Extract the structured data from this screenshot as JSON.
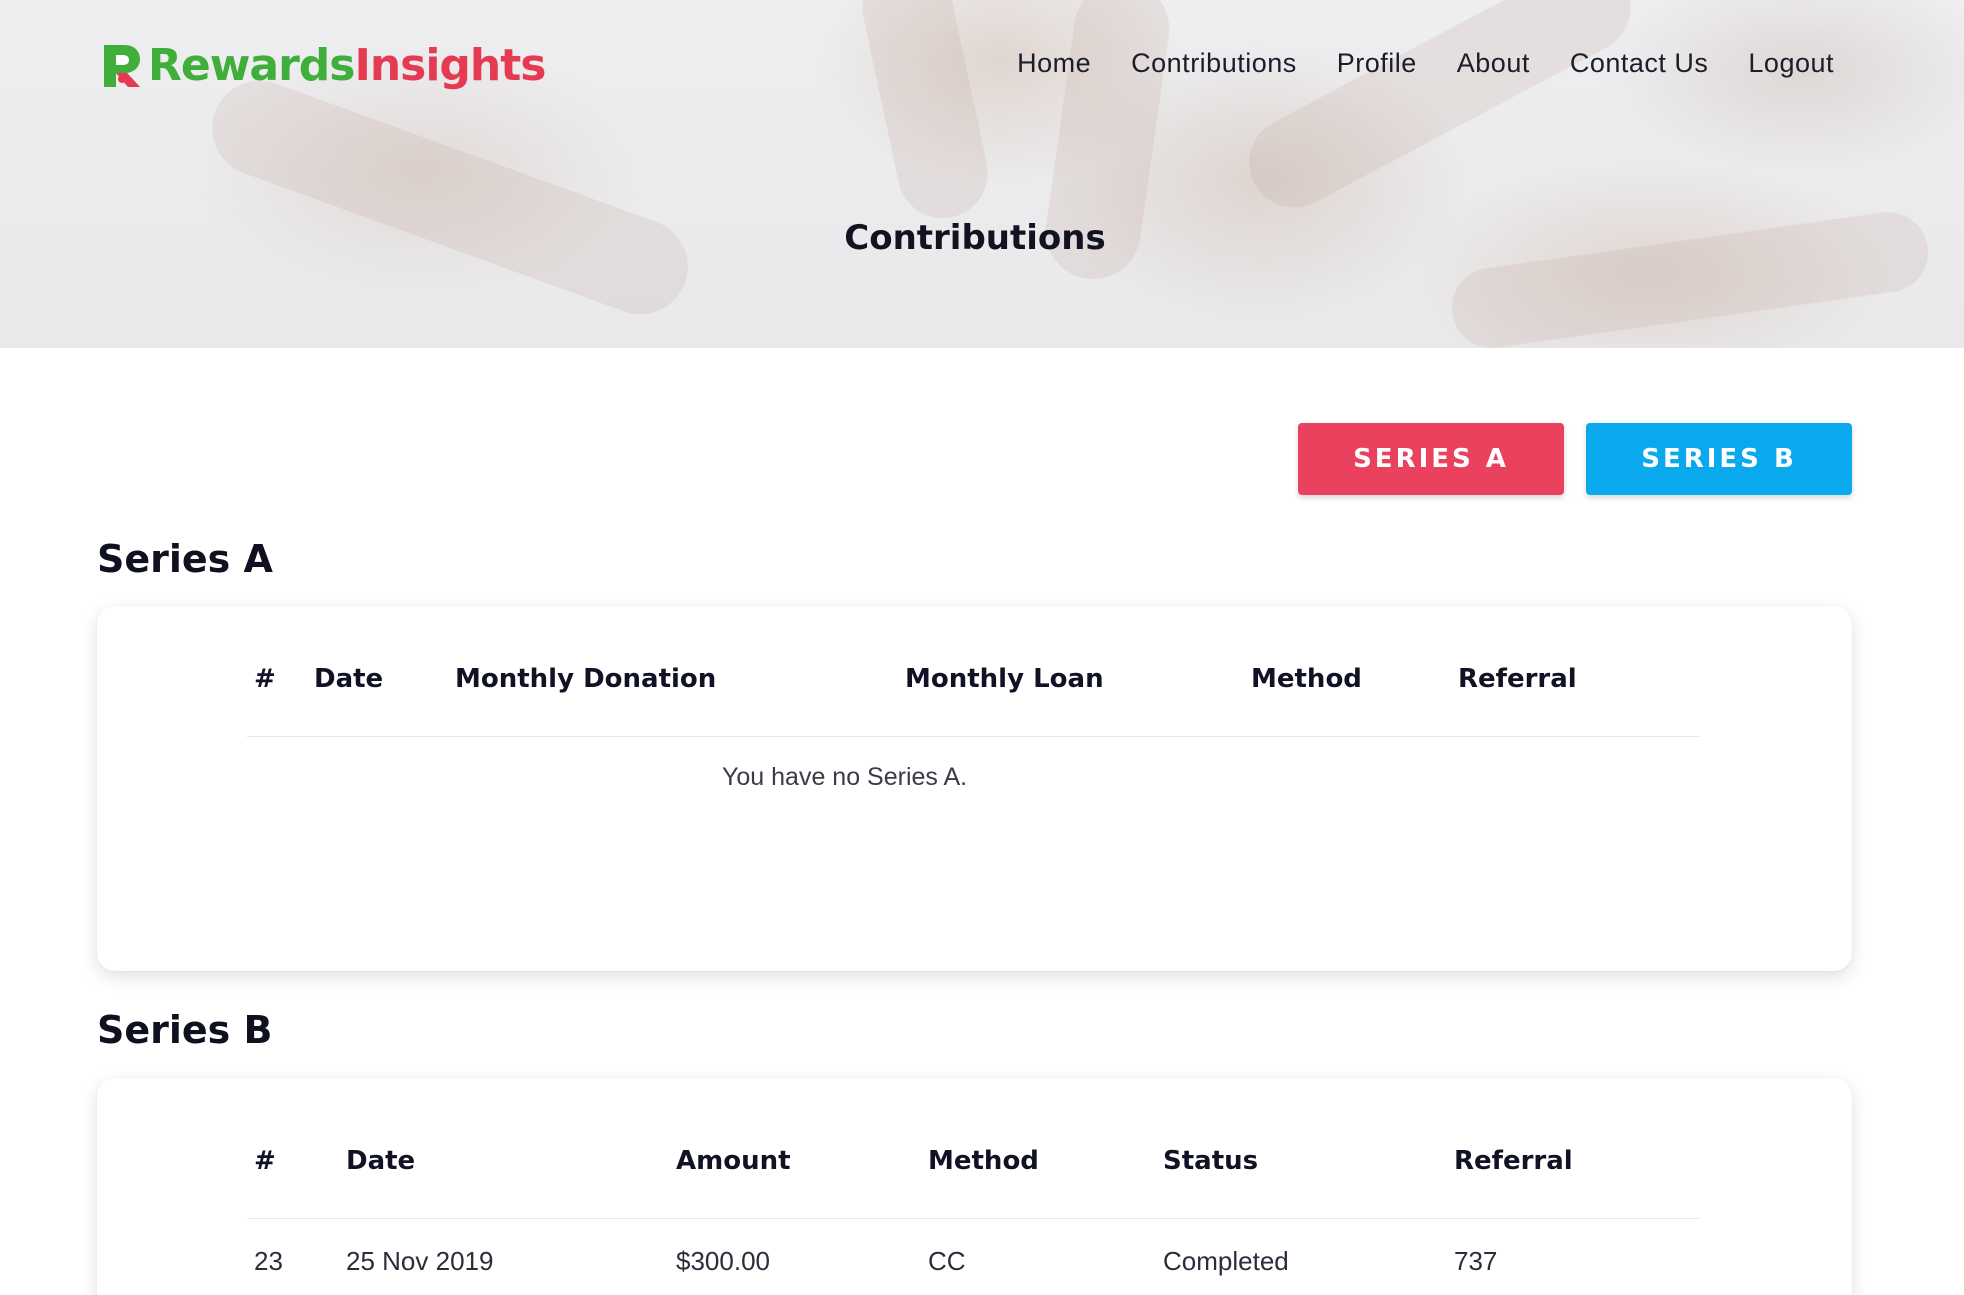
{
  "brand": {
    "logo_letter": "R",
    "name_part1": "Rewards",
    "name_part2": "Insights",
    "colors": {
      "green": "#3fae3a",
      "red": "#e53b52"
    }
  },
  "nav": {
    "items": [
      "Home",
      "Contributions",
      "Profile",
      "About",
      "Contact Us",
      "Logout"
    ]
  },
  "hero": {
    "title": "Contributions"
  },
  "buttons": {
    "series_a": "SERIES A",
    "series_b": "SERIES B",
    "colors": {
      "series_a": "#e9415e",
      "series_b": "#0aa8ec"
    }
  },
  "series_a": {
    "title": "Series A",
    "columns": [
      "#",
      "Date",
      "Monthly Donation",
      "Monthly Loan",
      "Method",
      "Referral"
    ],
    "empty_message": "You have no Series A."
  },
  "series_b": {
    "title": "Series B",
    "columns": [
      "#",
      "Date",
      "Amount",
      "Method",
      "Status",
      "Referral"
    ],
    "rows": [
      [
        "23",
        "25 Nov 2019",
        "$300.00",
        "CC",
        "Completed",
        "737"
      ]
    ]
  }
}
